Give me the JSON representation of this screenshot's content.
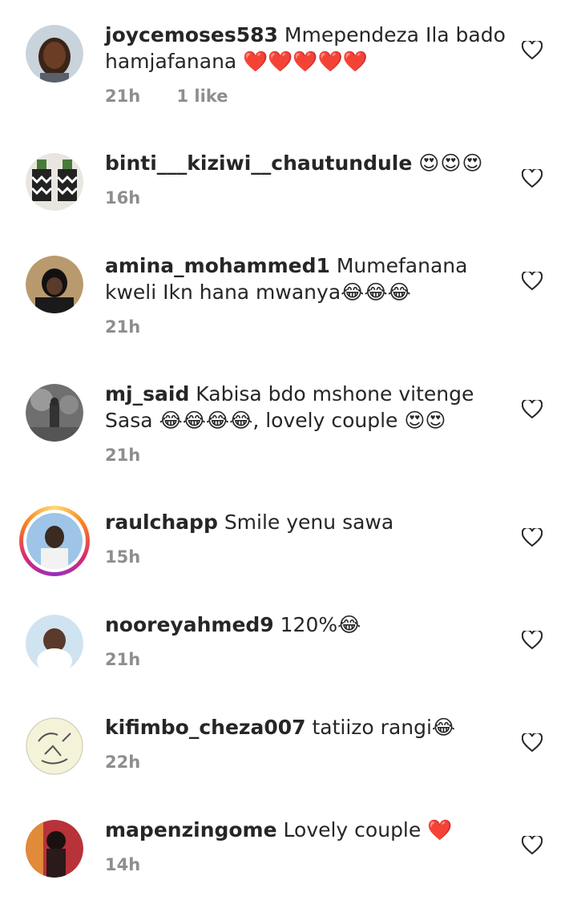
{
  "comments": [
    {
      "username": "joycemoses583",
      "text": "Mmependeza Ila bado hamjafanana ❤️❤️❤️❤️❤️",
      "time": "21h",
      "likes": "1 like"
    },
    {
      "username": "binti___kiziwi__chautundule",
      "text": "😍😍😍",
      "time": "16h",
      "likes": ""
    },
    {
      "username": "amina_mohammed1",
      "text": "Mumefanana kweli Ikn hana mwanya😂😂😂",
      "time": "21h",
      "likes": ""
    },
    {
      "username": "mj_said",
      "text": "Kabisa bdo mshone vitenge Sasa 😂😂😂😂, lovely couple 😍😍",
      "time": "21h",
      "likes": ""
    },
    {
      "username": "raulchapp",
      "text": "Smile yenu sawa",
      "time": "15h",
      "likes": ""
    },
    {
      "username": "nooreyahmed9",
      "text": "120%😂",
      "time": "21h",
      "likes": ""
    },
    {
      "username": "kifimbo_cheza007",
      "text": "tatiizo rangi😂",
      "time": "22h",
      "likes": ""
    },
    {
      "username": "mapenzingome",
      "text": "Lovely couple ❤️",
      "time": "14h",
      "likes": ""
    }
  ],
  "icons": {
    "like": "heart-outline-icon"
  },
  "colors": {
    "text": "#262626",
    "meta": "#8e8e8e"
  }
}
